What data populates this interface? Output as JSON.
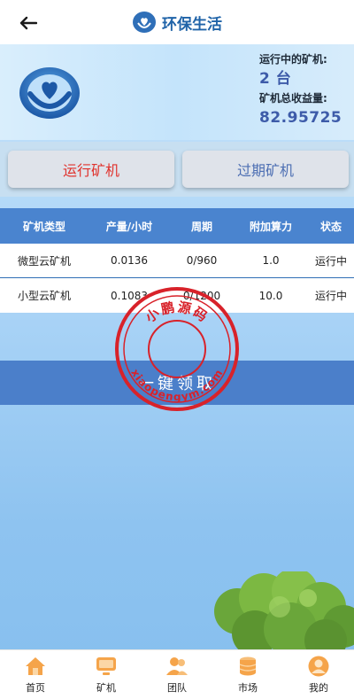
{
  "header": {
    "title": "环保生活"
  },
  "stats": {
    "running_label": "运行中的矿机:",
    "running_value": "2 台",
    "earnings_label": "矿机总收益量:",
    "earnings_value": "82.95725"
  },
  "tabs": [
    {
      "label": "运行矿机",
      "active": true
    },
    {
      "label": "过期矿机",
      "active": false
    }
  ],
  "table": {
    "headers": [
      "矿机类型",
      "产量/小时",
      "周期",
      "附加算力",
      "状态"
    ],
    "rows": [
      [
        "微型云矿机",
        "0.0136",
        "0/960",
        "1.0",
        "运行中"
      ],
      [
        "小型云矿机",
        "0.1083",
        "0/1200",
        "10.0",
        "运行中"
      ]
    ]
  },
  "claim_button": {
    "label": "一键领取"
  },
  "watermark": {
    "top_text": "小鹏源码",
    "bottom_text": "xiaopengym.com"
  },
  "bottom_nav": [
    {
      "label": "首页",
      "icon": "home-icon"
    },
    {
      "label": "矿机",
      "icon": "monitor-icon"
    },
    {
      "label": "团队",
      "icon": "team-icon"
    },
    {
      "label": "市场",
      "icon": "coins-icon"
    },
    {
      "label": "我的",
      "icon": "user-icon"
    }
  ],
  "colors": {
    "accent": "#4a84cf",
    "active_tab": "#e0322c",
    "inactive_tab": "#4d6fb3",
    "stamp": "#d8222a",
    "nav_icon": "#f5a44a"
  }
}
